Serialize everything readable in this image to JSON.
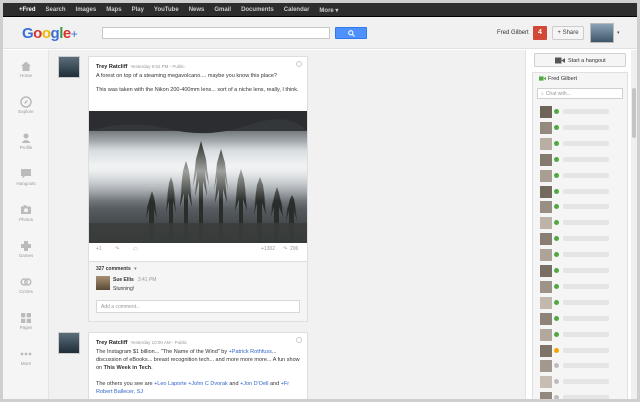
{
  "topbar": {
    "items": [
      "+Fred",
      "Search",
      "Images",
      "Maps",
      "Play",
      "YouTube",
      "News",
      "Gmail",
      "Documents",
      "Calendar",
      "More ▾"
    ]
  },
  "header": {
    "logo": {
      "letters": [
        "G",
        "o",
        "o",
        "g",
        "l",
        "e"
      ],
      "plus": "+"
    },
    "search_value": "",
    "user_name": "Fred Gilbert",
    "notification_count": "4",
    "share_label": "+ Share",
    "caret": "▾"
  },
  "rail": {
    "items": [
      {
        "label": "Home",
        "icon": "home-icon"
      },
      {
        "label": "Explore",
        "icon": "compass-icon"
      },
      {
        "label": "Profile",
        "icon": "profile-icon"
      },
      {
        "label": "Hangouts",
        "icon": "hangouts-icon"
      },
      {
        "label": "Photos",
        "icon": "photos-icon"
      },
      {
        "label": "Games",
        "icon": "games-icon"
      },
      {
        "label": "Circles",
        "icon": "circles-icon"
      },
      {
        "label": "Pages",
        "icon": "pages-icon"
      },
      {
        "label": "More",
        "icon": "more-icon"
      }
    ]
  },
  "post1": {
    "author": "Trey Ratcliff",
    "meta": "Yesterday 9:52 PM  -  Public",
    "text1": "A forest on top of a steaming megavolcano.... maybe you know this place?",
    "text2": "This was taken with the Nikon 200-400mm lens... sort of a niche lens, really, I think.",
    "plus_count": "+1",
    "plus_total": "+1302",
    "shares": "206",
    "comments_count": "327 comments",
    "comments_caret": "▾",
    "comment": {
      "name": "Sue Ellis",
      "time": "3:41 PM",
      "text": "Stunning!"
    },
    "comment_placeholder": "Add a comment..."
  },
  "post2": {
    "author": "Trey Ratcliff",
    "meta": "Yesterday 10:00 AM  -  Public",
    "t_a": "The Instagram $1 billion... \"The Name of the Wind\" by ",
    "link1": "+Patrick Rothfuss",
    "t_b": "... discussion of eBooks... breast recognition tech... and more more more... A fun show on ",
    "bold1": "This Week in Tech",
    "t_c": ".",
    "t_d": "The others you see are ",
    "link2": "+Leo Laporte",
    "link3": "+John C Dvorak",
    "t_e": " and ",
    "link4": "+Jon D'Oell",
    "t_f": " and ",
    "link5": "+Fr Robert Ballecer, SJ"
  },
  "sidebar": {
    "hangout_label": "Start a hangout",
    "chat_user": "Fred Gilbert",
    "chat_placeholder": "Chat with...",
    "contacts": [
      {
        "status": "#53a93f",
        "icon": "online-dot"
      },
      {
        "status": "#53a93f",
        "icon": "online-dot"
      },
      {
        "status": "#53a93f",
        "icon": "online-dot"
      },
      {
        "status": "#53a93f",
        "icon": "online-dot"
      },
      {
        "status": "#53a93f",
        "icon": "video-dot"
      },
      {
        "status": "#53a93f",
        "icon": "online-dot"
      },
      {
        "status": "#53a93f",
        "icon": "online-dot"
      },
      {
        "status": "#53a93f",
        "icon": "online-dot"
      },
      {
        "status": "#53a93f",
        "icon": "online-dot"
      },
      {
        "status": "#53a93f",
        "icon": "video-dot"
      },
      {
        "status": "#53a93f",
        "icon": "online-dot"
      },
      {
        "status": "#53a93f",
        "icon": "online-dot"
      },
      {
        "status": "#53a93f",
        "icon": "online-dot"
      },
      {
        "status": "#53a93f",
        "icon": "video-dot"
      },
      {
        "status": "#53a93f",
        "icon": "online-dot"
      },
      {
        "status": "#f2a600",
        "icon": "idle-dot"
      },
      {
        "status": "#bdbdbd",
        "icon": "offline-dot"
      },
      {
        "status": "#bdbdbd",
        "icon": "offline-dot"
      },
      {
        "status": "#bdbdbd",
        "icon": "offline-dot"
      }
    ]
  },
  "colors": {
    "accent": "#4d90fe",
    "notif": "#d14836",
    "online": "#53a93f",
    "link": "#3366cc"
  }
}
